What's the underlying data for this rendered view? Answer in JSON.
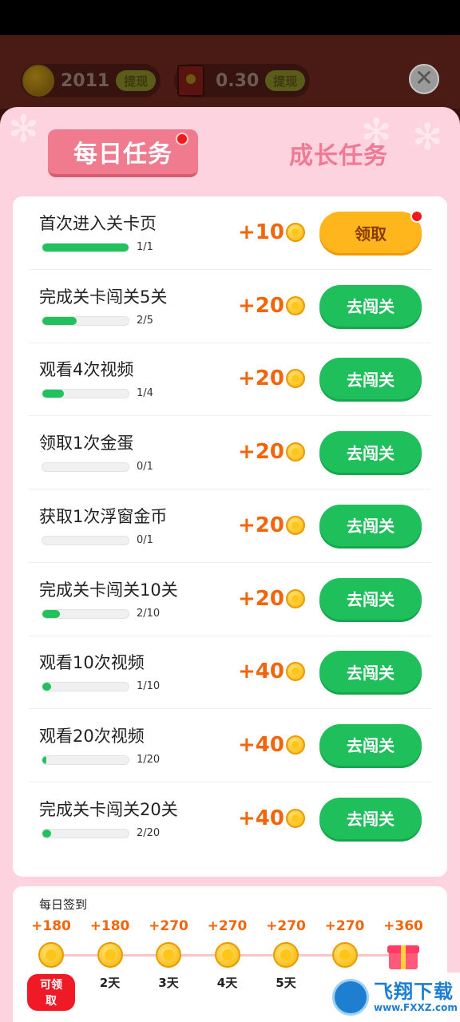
{
  "header": {
    "coins_amount": "2011",
    "coins_withdraw_label": "提现",
    "cash_amount": "0.30",
    "cash_withdraw_label": "提现",
    "close_symbol": "✕"
  },
  "tabs": {
    "daily_label": "每日任务",
    "growth_label": "成长任务"
  },
  "tasks": [
    {
      "title": "首次进入关卡页",
      "progress_text": "1/1",
      "progress": 1.0,
      "reward": "+10",
      "button": "领取",
      "button_type": "claim",
      "badge": true
    },
    {
      "title": "完成关卡闯关5关",
      "progress_text": "2/5",
      "progress": 0.4,
      "reward": "+20",
      "button": "去闯关",
      "button_type": "go",
      "badge": false
    },
    {
      "title": "观看4次视频",
      "progress_text": "1/4",
      "progress": 0.25,
      "reward": "+20",
      "button": "去闯关",
      "button_type": "go",
      "badge": false
    },
    {
      "title": "领取1次金蛋",
      "progress_text": "0/1",
      "progress": 0,
      "reward": "+20",
      "button": "去闯关",
      "button_type": "go",
      "badge": false
    },
    {
      "title": "获取1次浮窗金币",
      "progress_text": "0/1",
      "progress": 0,
      "reward": "+20",
      "button": "去闯关",
      "button_type": "go",
      "badge": false
    },
    {
      "title": "完成关卡闯关10关",
      "progress_text": "2/10",
      "progress": 0.2,
      "reward": "+20",
      "button": "去闯关",
      "button_type": "go",
      "badge": false
    },
    {
      "title": "观看10次视频",
      "progress_text": "1/10",
      "progress": 0.1,
      "reward": "+40",
      "button": "去闯关",
      "button_type": "go",
      "badge": false
    },
    {
      "title": "观看20次视频",
      "progress_text": "1/20",
      "progress": 0.05,
      "reward": "+40",
      "button": "去闯关",
      "button_type": "go",
      "badge": false
    },
    {
      "title": "完成关卡闯关20关",
      "progress_text": "2/20",
      "progress": 0.1,
      "reward": "+40",
      "button": "去闯关",
      "button_type": "go",
      "badge": false
    }
  ],
  "signin": {
    "title": "每日签到",
    "days": [
      {
        "reward": "+180",
        "label": "可领取",
        "current": true
      },
      {
        "reward": "+180",
        "label": "2天",
        "current": false
      },
      {
        "reward": "+270",
        "label": "3天",
        "current": false
      },
      {
        "reward": "+270",
        "label": "4天",
        "current": false
      },
      {
        "reward": "+270",
        "label": "5天",
        "current": false
      },
      {
        "reward": "+270",
        "label": "",
        "current": false
      },
      {
        "reward": "+360",
        "label": "",
        "current": false,
        "gift": true
      }
    ]
  },
  "watermark": {
    "name": "飞翔下载",
    "url": "www.FXXZ.com"
  },
  "colors": {
    "green_button": "#1fbf5c",
    "claim_button": "#ffb61c",
    "reward_orange": "#f2650b",
    "panel_pink": "#fcd3de",
    "tab_active": "#f07a8e"
  }
}
